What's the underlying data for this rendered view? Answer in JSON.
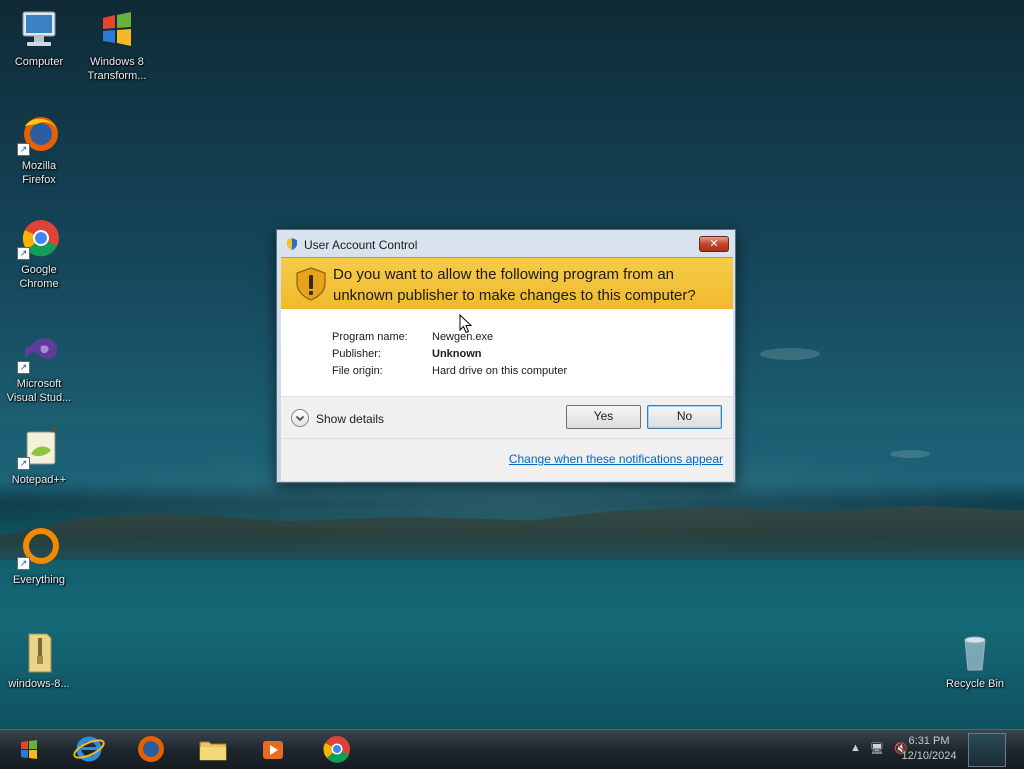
{
  "desktop": {
    "icons": [
      {
        "label": "Computer",
        "icon": "computer-icon"
      },
      {
        "label": "Windows 8\nTransform...",
        "icon": "windows-logo-icon"
      },
      {
        "label": "Mozilla\nFirefox",
        "icon": "firefox-icon"
      },
      {
        "label": "Google\nChrome",
        "icon": "chrome-icon"
      },
      {
        "label": "Microsoft\nVisual Stud...",
        "icon": "visual-studio-icon"
      },
      {
        "label": "Notepad++",
        "icon": "notepad-plus-plus-icon"
      },
      {
        "label": "Everything",
        "icon": "everything-search-icon"
      },
      {
        "label": "windows-8...",
        "icon": "zip-folder-icon"
      },
      {
        "label": "Recycle Bin",
        "icon": "recycle-bin-icon"
      }
    ]
  },
  "dialog": {
    "title": "User Account Control",
    "question": "Do you want to allow the following program from an unknown publisher to make changes to this computer?",
    "program_name_label": "Program name:",
    "program_name": "Newgen.exe",
    "publisher_label": "Publisher:",
    "publisher": "Unknown",
    "file_origin_label": "File origin:",
    "file_origin": "Hard drive on this computer",
    "show_details": "Show details",
    "yes": "Yes",
    "no": "No",
    "change_link": "Change when these notifications appear",
    "banner_color": "#f2c23a"
  },
  "taskbar": {
    "items": [
      "start-button",
      "internet-explorer-icon",
      "firefox-icon",
      "file-explorer-icon",
      "media-player-icon",
      "chrome-icon"
    ],
    "clock_time": "6:31 PM",
    "clock_date": "12/10/2024"
  }
}
